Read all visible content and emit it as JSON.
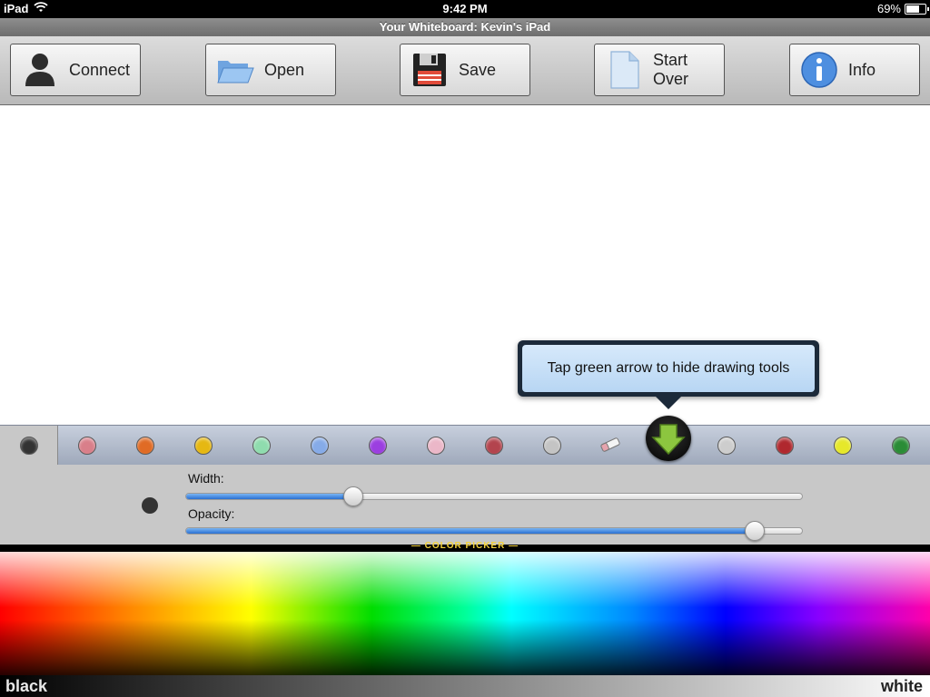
{
  "status_bar": {
    "device": "iPad",
    "time": "9:42 PM",
    "battery": "69%",
    "battery_level": 0.69
  },
  "title_bar": {
    "title": "Your Whiteboard: Kevin's iPad"
  },
  "toolbar": {
    "buttons": [
      {
        "label": "Connect",
        "icon": "person-icon"
      },
      {
        "label": "Open",
        "icon": "folder-icon"
      },
      {
        "label": "Save",
        "icon": "floppy-disk-icon"
      },
      {
        "label": "Start Over",
        "icon": "blank-page-icon"
      },
      {
        "label": "Info",
        "icon": "info-icon"
      }
    ]
  },
  "tooltip": {
    "text": "Tap green arrow to hide drawing tools"
  },
  "palette": {
    "selected_color": "#333333",
    "swatches": [
      "#d97f8a",
      "#e06b25",
      "#e6b812",
      "#8fdcae",
      "#86abe8",
      "#9b3fe0",
      "#ebb7c8",
      "#b3444e",
      "#c4c4c4",
      "eraser",
      "arrow",
      "#cdcdcd",
      "#b0282e",
      "#e6e82a",
      "#2a8c36"
    ]
  },
  "sliders": {
    "width": {
      "label": "Width:",
      "value": 0.27
    },
    "opacity": {
      "label": "Opacity:",
      "value": 0.92
    }
  },
  "color_picker": {
    "title": "— COLOR PICKER —",
    "left_label": "black",
    "right_label": "white"
  }
}
